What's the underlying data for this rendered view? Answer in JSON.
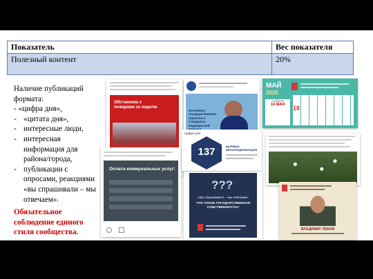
{
  "table": {
    "header": {
      "col1": "Показатель",
      "col2": "Вес показателя"
    },
    "row": {
      "col1": "Полезный контент",
      "col2": "20%"
    }
  },
  "left": {
    "intro": "Наличие публикаций формата:",
    "items": [
      "- «цифра дня»,",
      "«цитата дня»,",
      "интересные люди,",
      "интересная информация для района/города,",
      "публикации с опросами, реакциями «вы спрашивали – мы отвечаем»."
    ],
    "bullets": [
      "-",
      "-",
      "-",
      "-"
    ],
    "note": "Обязательное соблюдение единого стиля сообщества."
  },
  "cards": {
    "fire": {
      "title": "Обстановка с пожарами за неделю"
    },
    "quote": {
      "text": "Основные государственные гарантии и стандарты медицинской помощи"
    },
    "may": {
      "month": "МАЙ",
      "year": "2020",
      "weekday": "Суббота",
      "date": "16 МАЯ",
      "big": "18"
    },
    "utility": {
      "title": "Оплата коммунальных услуг:"
    },
    "number": {
      "caption": "Цифра дня",
      "value": "137",
      "label": "рулевых металлодетекторов"
    },
    "question": {
      "marks": "???",
      "banner": "«Вы спрашиваете – мы отвечаем»",
      "title": "ЧТО ТАКОЕ ГОСУДАРСТВЕННАЯ СОБСТВЕННОСТЬ?"
    },
    "person": {
      "name": "ВЛАДИМИР ЛЕБОВ"
    }
  },
  "colors": {
    "accent": "#c00000",
    "table_fill": "#c9d6ec",
    "table_border": "#5a7ab0"
  }
}
